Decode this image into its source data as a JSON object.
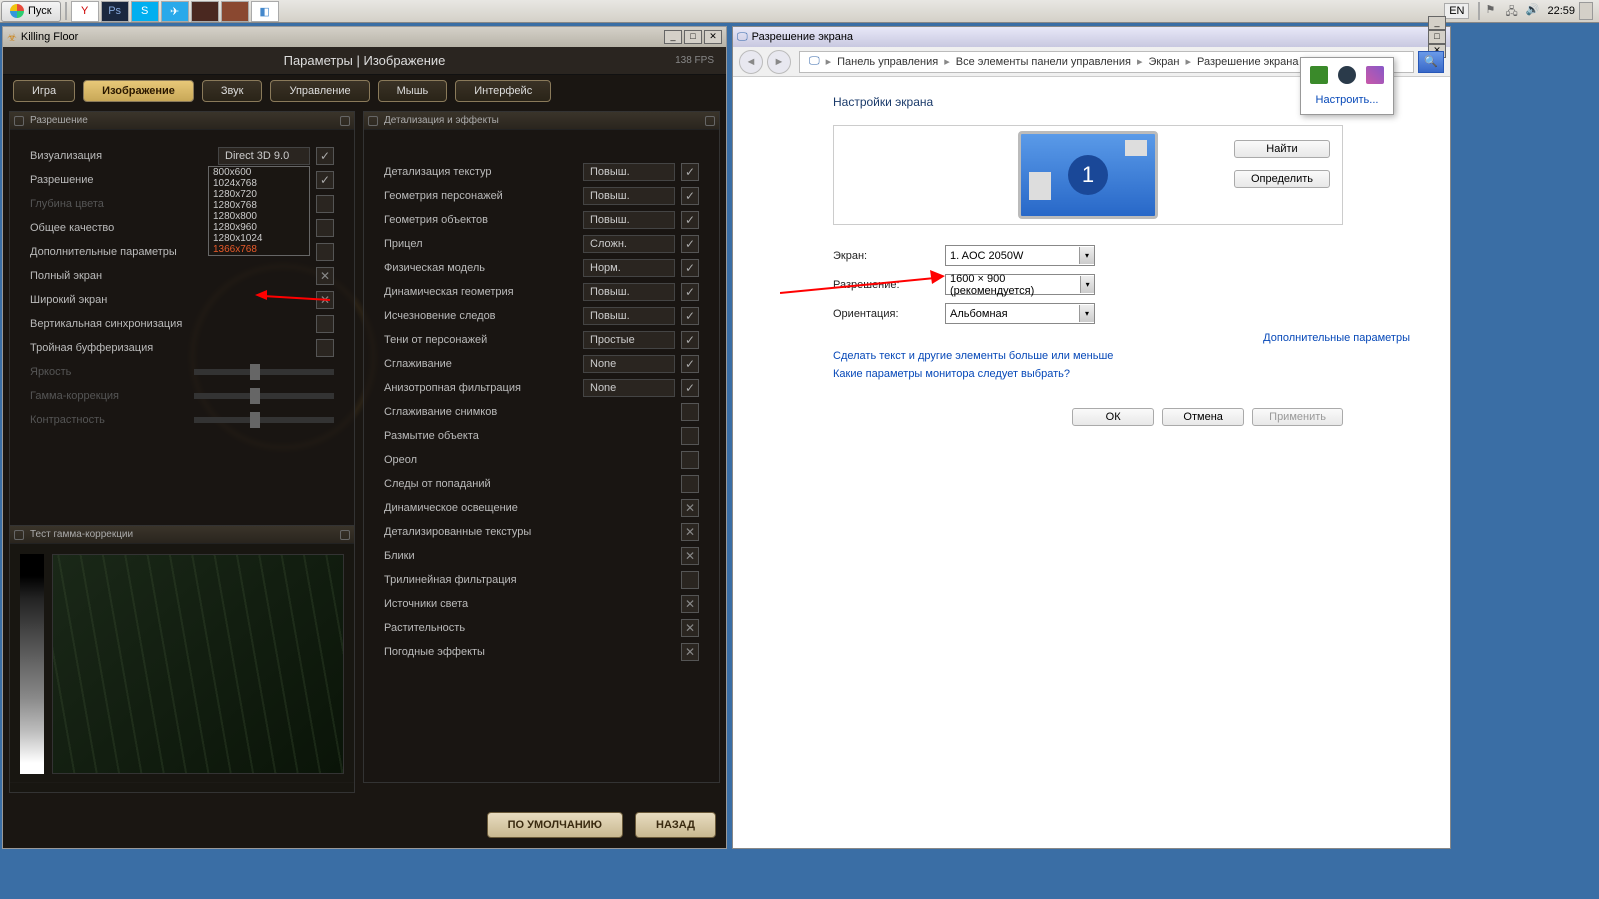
{
  "taskbar": {
    "start": "Пуск",
    "lang": "EN",
    "time": "22:59"
  },
  "game": {
    "title": "Killing Floor",
    "header": "Параметры | Изображение",
    "fps": "138 FPS",
    "tabs": [
      "Игра",
      "Изображение",
      "Звук",
      "Управление",
      "Мышь",
      "Интерфейс"
    ],
    "panel_left_title": "Разрешение",
    "panel_right_title": "Детализация и эффекты",
    "left_rows": [
      {
        "label": "Визуализация",
        "value": "Direct 3D 9.0",
        "check": true
      },
      {
        "label": "Разрешение",
        "value": "1366x768",
        "check": true
      },
      {
        "label": "Глубина цвета",
        "dim": true
      },
      {
        "label": "Общее качество"
      },
      {
        "label": "Дополнительные параметры"
      },
      {
        "label": "Полный экран",
        "x": true
      },
      {
        "label": "Широкий экран",
        "x": true
      },
      {
        "label": "Вертикальная синхронизация"
      },
      {
        "label": "Тройная буфферизация"
      },
      {
        "label": "Яркость",
        "dim": true,
        "slider": true
      },
      {
        "label": "Гамма-коррекция",
        "dim": true,
        "slider": true
      },
      {
        "label": "Контрастность",
        "dim": true,
        "slider": true
      }
    ],
    "dropdown": [
      "800x600",
      "1024x768",
      "1280x720",
      "1280x768",
      "1280x800",
      "1280x960",
      "1280x1024",
      "1366x768"
    ],
    "right_rows": [
      {
        "label": "Детализация текстур",
        "value": "Повыш.",
        "check": true
      },
      {
        "label": "Геометрия персонажей",
        "value": "Повыш.",
        "check": true
      },
      {
        "label": "Геометрия объектов",
        "value": "Повыш.",
        "check": true
      },
      {
        "label": "Прицел",
        "value": "Сложн.",
        "check": true
      },
      {
        "label": "Физическая модель",
        "value": "Норм.",
        "check": true
      },
      {
        "label": "Динамическая геометрия",
        "value": "Повыш.",
        "check": true
      },
      {
        "label": "Исчезновение следов",
        "value": "Повыш.",
        "check": true
      },
      {
        "label": "Тени от персонажей",
        "value": "Простые",
        "check": true
      },
      {
        "label": "Сглаживание",
        "value": "None",
        "check": true
      },
      {
        "label": "Анизотропная фильтрация",
        "value": "None",
        "check": true
      },
      {
        "label": "Сглаживание снимков"
      },
      {
        "label": "Размытие объекта"
      },
      {
        "label": "Ореол"
      },
      {
        "label": "Следы от попаданий"
      },
      {
        "label": "Динамическое освещение",
        "x": true
      },
      {
        "label": "Детализированные текстуры",
        "x": true
      },
      {
        "label": "Блики",
        "x": true
      },
      {
        "label": "Трилинейная фильтрация"
      },
      {
        "label": "Источники света",
        "x": true
      },
      {
        "label": "Растительность",
        "x": true
      },
      {
        "label": "Погодные эффекты",
        "x": true
      }
    ],
    "gamma_title": "Тест гамма-коррекции",
    "btn_default": "ПО УМОЛЧАНИЮ",
    "btn_back": "НАЗАД"
  },
  "cp": {
    "title": "Разрешение экрана",
    "crumbs": [
      "Панель управления",
      "Все элементы панели управления",
      "Экран",
      "Разрешение экрана"
    ],
    "heading": "Настройки экрана",
    "btn_find": "Найти",
    "btn_detect": "Определить",
    "monitor_num": "1",
    "screen_label": "Экран:",
    "screen_value": "1. AOC 2050W",
    "res_label": "Разрешение:",
    "res_value": "1600 × 900 (рекомендуется)",
    "orient_label": "Ориентация:",
    "orient_value": "Альбомная",
    "link_extra": "Дополнительные параметры",
    "link_text": "Сделать текст и другие элементы больше или меньше",
    "link_which": "Какие параметры монитора следует выбрать?",
    "btn_ok": "ОК",
    "btn_cancel": "Отмена",
    "btn_apply": "Применить",
    "popup_link": "Настроить..."
  }
}
